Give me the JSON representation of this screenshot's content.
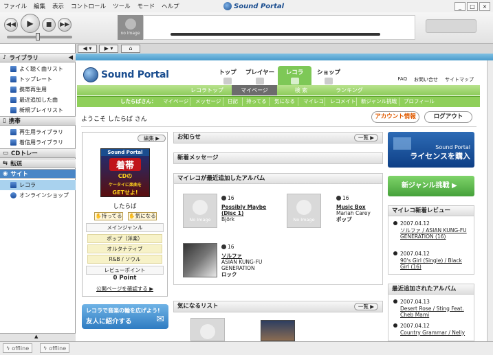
{
  "menu": [
    "ファイル",
    "編集",
    "表示",
    "コントロール",
    "ツール",
    "モード",
    "ヘルプ"
  ],
  "app_title": "Sound Portal",
  "window_buttons": [
    "_",
    "□",
    "×"
  ],
  "player": {
    "no_image": "no image"
  },
  "sidebar": {
    "library": {
      "label": "ライブラリ",
      "items": [
        "よく聴く曲リスト",
        "トップレート",
        "携帯再生用",
        "最近追加した曲",
        "新規プレイリスト"
      ]
    },
    "mobile": {
      "label": "携帯",
      "items": [
        "再生用ライブラリ",
        "着信用ライブラリ"
      ]
    },
    "cd": {
      "label": "CDトレー"
    },
    "transfer": {
      "label": "転送"
    },
    "site": {
      "label": "サイト",
      "items": [
        "レコラ",
        "オンラインショップ"
      ]
    }
  },
  "status": {
    "offline1": "offline",
    "offline2": "offline"
  },
  "site": {
    "logo_text": "Sound Portal",
    "top_nav": [
      "トップ",
      "プレイヤー",
      "レコラ",
      "ショップ"
    ],
    "top_links": [
      "FAQ",
      "お問い合せ",
      "サイトマップ"
    ],
    "green_nav1": [
      "レコラトップ",
      "マイページ",
      "検 索",
      "ランキング"
    ],
    "user_prefix": "したらばさん：",
    "green_nav2": [
      "マイページ",
      "メッセージ",
      "日記",
      "持ってる",
      "気になる",
      "マイレコ",
      "レコメイト",
      "新ジャンル挑戦",
      "プロフィール"
    ],
    "welcome": "ようこそ したらば さん",
    "account_button": "アカウント情報",
    "logout_button": "ログアウト",
    "profile": {
      "edit": "編集",
      "ad_brand": "Sound Portal",
      "ad_main": "着帯",
      "ad_sub": "CDの",
      "ad_sub2": "ケータイに楽曲を",
      "ad_sub3": "GETせよ!",
      "name": "したらば",
      "have_btn": "持ってる",
      "want_btn": "気になる",
      "main_genre_label": "メインジャンル",
      "genres": [
        "ポップ（洋楽）",
        "オルタナティブ",
        "R&B / ソウル"
      ],
      "review_point_label": "レビューポイント",
      "review_point": "0 Point",
      "public_link": "公開ページを確認する"
    },
    "friend_banner": {
      "line1": "レコラで音楽の輪を広げよう!",
      "line2": "友人に紹介する"
    },
    "center": {
      "news": "お知らせ",
      "list_btn": "一覧",
      "new_messages": "新着メッセージ",
      "recent_albums": "マイレコが最近追加したアルバム",
      "albums": [
        {
          "count": "16",
          "title": "Possibly Maybe (Disc 1)",
          "artist": "Björk",
          "genre": ""
        },
        {
          "count": "16",
          "title": "Music Box",
          "artist": "Mariah Carey",
          "genre": "ポップ"
        },
        {
          "count": "16",
          "title": "ソルファ",
          "artist": "ASIAN KUNG-FU GENERATION",
          "genre": "ロック"
        }
      ],
      "no_image": "No Image",
      "kininaru": "気になるリスト"
    },
    "right": {
      "license_small": "Sound Portal",
      "license_big": "ライセンスを購入",
      "new_genre": "新ジャンル挑戦",
      "reviews_title": "マイレコ新着レビュー",
      "reviews": [
        {
          "date": "2007.04.12",
          "text": "ソルファ / ASIAN KUNG-FU GENERATION (16)"
        },
        {
          "date": "2007.04.12",
          "text": "90's Girl (Single) / Black Girl (16)"
        }
      ],
      "recent_albums_title": "最近追加されたアルバム",
      "recent_albums": [
        {
          "date": "2007.04.13",
          "text": "Desert Rose / Sting Feat. Cheb Mami"
        },
        {
          "date": "2007.04.12",
          "text": "Country Grammar / Nelly"
        }
      ]
    }
  }
}
